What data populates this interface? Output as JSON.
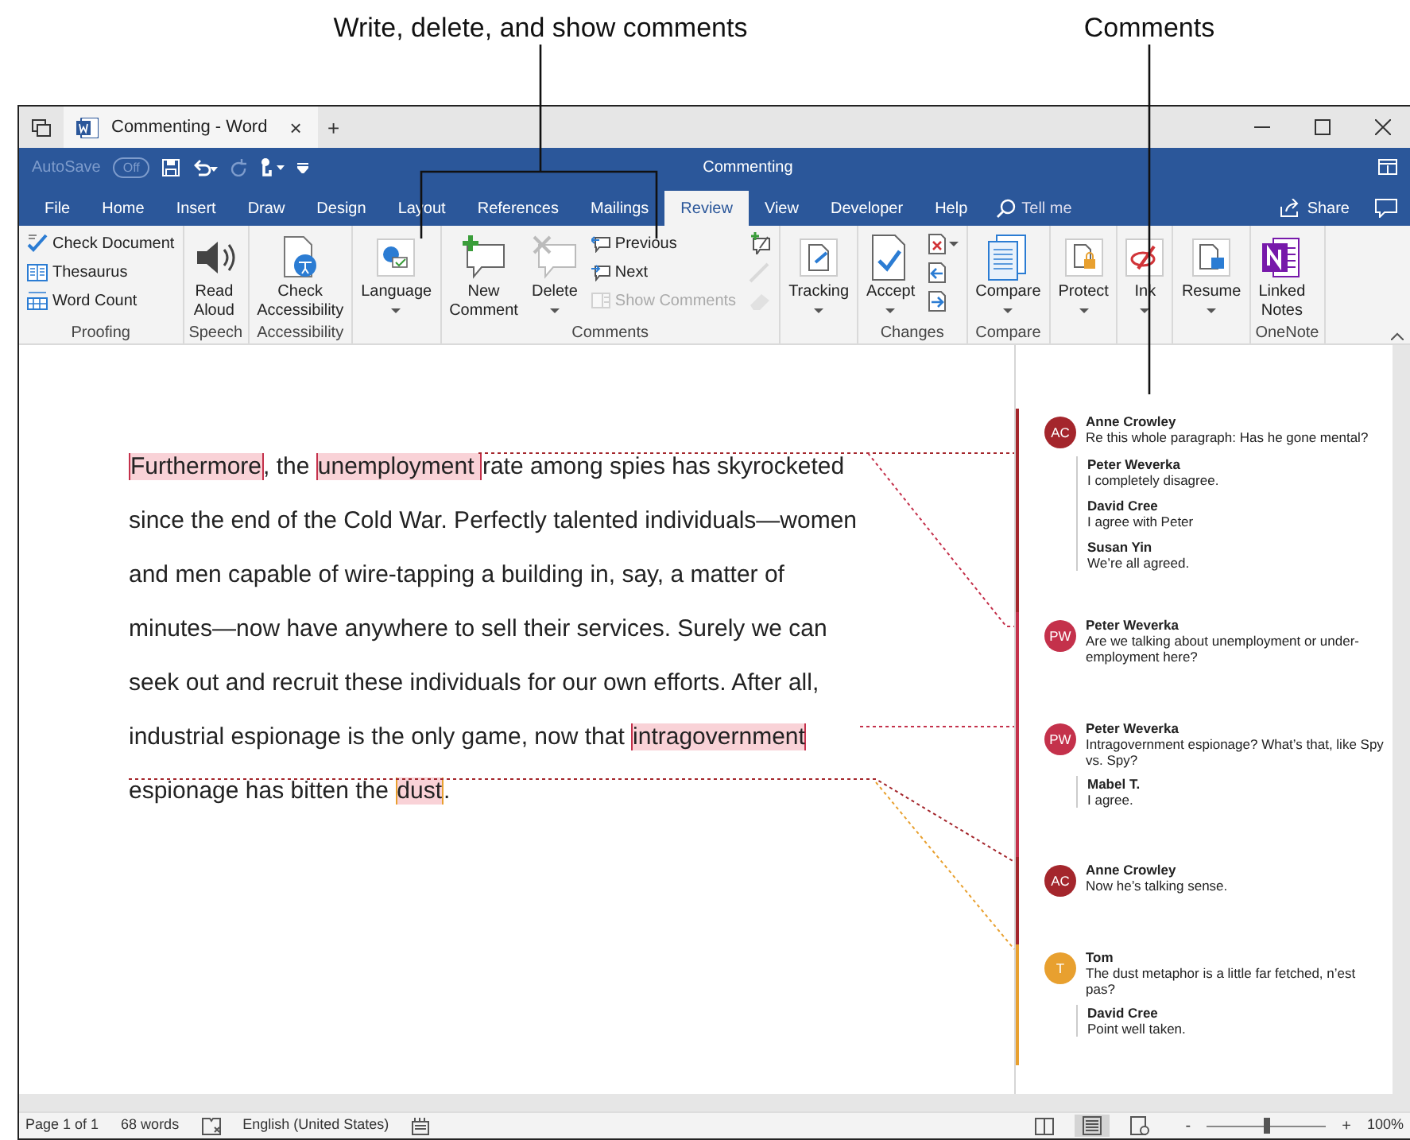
{
  "callouts": [
    {
      "text": "Write, delete, and show comments"
    },
    {
      "text": "Comments"
    }
  ],
  "window": {
    "tab_title": "Commenting - Word",
    "tab_close": "×",
    "new_tab": "+"
  },
  "title_bar": {
    "autosave_label": "AutoSave",
    "autosave": {
      "on": false,
      "text": "Off"
    },
    "title": "Commenting"
  },
  "ribbon_tabs": [
    {
      "label": "File",
      "selected": false
    },
    {
      "label": "Home",
      "selected": false
    },
    {
      "label": "Insert",
      "selected": false
    },
    {
      "label": "Draw",
      "selected": false
    },
    {
      "label": "Design",
      "selected": false
    },
    {
      "label": "Layout",
      "selected": false
    },
    {
      "label": "References",
      "selected": false
    },
    {
      "label": "Mailings",
      "selected": false
    },
    {
      "label": "Review",
      "selected": true
    },
    {
      "label": "View",
      "selected": false
    },
    {
      "label": "Developer",
      "selected": false
    },
    {
      "label": "Help",
      "selected": false
    }
  ],
  "tell_me": "Tell me",
  "share": "Share",
  "ribbon_groups": [
    {
      "label": "Proofing",
      "columns": [
        {
          "kind": "small",
          "items": [
            {
              "label": "Check Document",
              "disabled": false
            },
            {
              "label": "Thesaurus",
              "disabled": false
            },
            {
              "label": "Word Count",
              "disabled": false
            }
          ]
        }
      ]
    },
    {
      "label": "Speech",
      "columns": [
        {
          "kind": "large",
          "items": [
            {
              "label": "Read Aloud",
              "dropdown": false
            }
          ]
        }
      ]
    },
    {
      "label": "Accessibility",
      "columns": [
        {
          "kind": "large",
          "items": [
            {
              "label": "Check Accessibility",
              "dropdown": false
            }
          ]
        }
      ]
    },
    {
      "columns": [
        {
          "kind": "large",
          "items": [
            {
              "label": "Language",
              "dropdown": true
            }
          ]
        }
      ]
    },
    {
      "label": "Comments",
      "columns": [
        {
          "kind": "large",
          "items": [
            {
              "label": "New Comment",
              "dropdown": false
            }
          ]
        },
        {
          "kind": "large",
          "items": [
            {
              "label": "Delete",
              "dropdown": true
            }
          ]
        },
        {
          "kind": "small",
          "items": [
            {
              "label": "Previous",
              "disabled": false
            },
            {
              "label": "Next",
              "disabled": false
            },
            {
              "label": "Show Comments",
              "disabled": true
            }
          ]
        },
        {
          "kind": "icon",
          "items": [
            {
              "disabled": false,
              "dropdown": false
            },
            {
              "disabled": true,
              "dropdown": false
            },
            {
              "disabled": true,
              "dropdown": false
            }
          ]
        }
      ]
    },
    {
      "columns": [
        {
          "kind": "large",
          "items": [
            {
              "label": "Tracking",
              "dropdown": true
            }
          ]
        }
      ]
    },
    {
      "label": "Changes",
      "columns": [
        {
          "kind": "large",
          "items": [
            {
              "label": "Accept",
              "dropdown": true
            }
          ]
        },
        {
          "kind": "icon",
          "items": [
            {
              "disabled": false,
              "dropdown": true
            },
            {
              "disabled": false,
              "dropdown": false
            },
            {
              "disabled": false,
              "dropdown": false
            }
          ]
        }
      ]
    },
    {
      "label": "Compare",
      "columns": [
        {
          "kind": "large",
          "items": [
            {
              "label": "Compare",
              "dropdown": true
            }
          ]
        }
      ]
    },
    {
      "columns": [
        {
          "kind": "large",
          "items": [
            {
              "label": "Protect",
              "dropdown": true
            }
          ]
        }
      ]
    },
    {
      "columns": [
        {
          "kind": "large",
          "items": [
            {
              "label": "Ink",
              "dropdown": true
            }
          ]
        }
      ]
    },
    {
      "columns": [
        {
          "kind": "large",
          "items": [
            {
              "label": "Resume",
              "dropdown": true
            }
          ]
        }
      ]
    },
    {
      "label": "OneNote",
      "columns": [
        {
          "kind": "large",
          "items": [
            {
              "label": "Linked Notes",
              "dropdown": false
            }
          ]
        }
      ]
    }
  ],
  "document": {
    "lines": [
      [
        {
          "text": "Furthermore",
          "comment": true,
          "color": "#c4314b"
        },
        {
          "text": ", the ",
          "comment": false
        },
        {
          "text": "unemployment ",
          "comment": true,
          "color": "#c4314b"
        },
        {
          "text": "rate among spies has skyrocketed",
          "comment": false
        }
      ],
      [
        {
          "text": "since the end of the Cold War. Perfectly talented individuals—women",
          "comment": false
        }
      ],
      [
        {
          "text": "and men capable of wire-tapping a building in, say, a matter of",
          "comment": false
        }
      ],
      [
        {
          "text": "minutes—now have anywhere to sell their services. Surely we can",
          "comment": false
        }
      ],
      [
        {
          "text": "seek out and recruit these individuals for our own efforts. After all,",
          "comment": false
        }
      ],
      [
        {
          "text": "industrial espionage is the only game, now that ",
          "comment": false
        },
        {
          "text": "intragovernment ",
          "comment": true,
          "color": "#c4314b"
        }
      ],
      [
        {
          "text": "espionage has bitten the ",
          "comment": false
        },
        {
          "text": "dust",
          "comment": true,
          "color": "#e8a02f"
        },
        {
          "text": ".",
          "comment": false
        }
      ]
    ]
  },
  "comments": [
    {
      "initials": "AC",
      "author": "Anne Crowley",
      "text": "Re this whole paragraph: Has he gone mental?",
      "color": "#a4262c",
      "replies": [
        {
          "author": "Peter Weverka",
          "text": "I completely disagree."
        },
        {
          "author": "David Cree",
          "text": "I agree with Peter"
        },
        {
          "author": "Susan Yin",
          "text": "We’re all agreed."
        }
      ]
    },
    {
      "initials": "PW",
      "author": "Peter Weverka",
      "text": "Are we talking about unemployment or under-employment here?",
      "color": "#c4314b"
    },
    {
      "initials": "PW",
      "author": "Peter Weverka",
      "text": "Intragovernment espionage? What’s that, like Spy vs. Spy?",
      "color": "#c4314b",
      "replies": [
        {
          "author": "Mabel T.",
          "text": "I agree."
        }
      ]
    },
    {
      "initials": "AC",
      "author": "Anne Crowley",
      "text": "Now he’s talking sense.",
      "color": "#a4262c"
    },
    {
      "initials": "T",
      "author": "Tom",
      "text": "The dust metaphor is a little far fetched, n’est pas?",
      "color": "#e8a02f",
      "replies": [
        {
          "author": "David Cree",
          "text": "Point well taken."
        }
      ]
    }
  ],
  "status_bar": {
    "page": "Page 1 of 1",
    "words": "68 words",
    "language": "English (United States)",
    "views": [
      {
        "selected": false
      },
      {
        "selected": true
      },
      {
        "selected": false
      }
    ],
    "zoom_minus": "-",
    "zoom_plus": "+",
    "zoom": {
      "level": 0.5
    },
    "zoom_text": "100%"
  }
}
